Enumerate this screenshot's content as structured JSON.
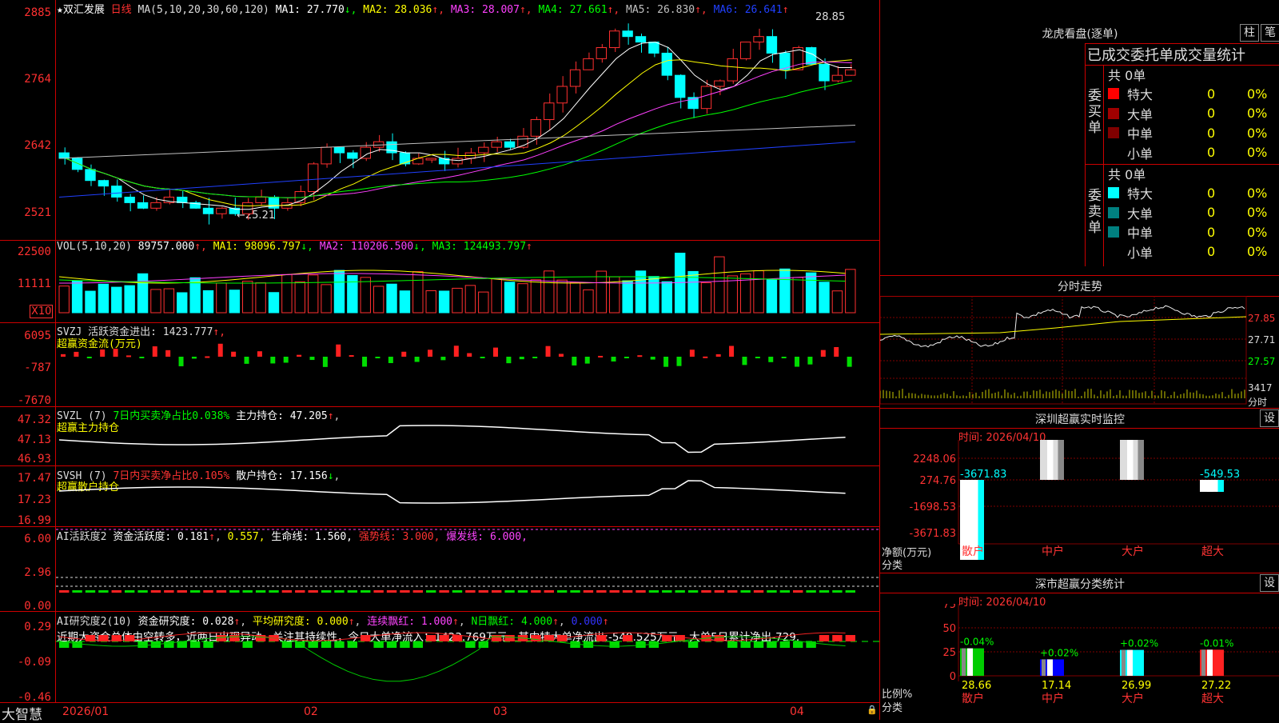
{
  "stock": {
    "name": "★双汇发展",
    "period": "日线",
    "ma_params": "MA(5,10,20,30,60,120)",
    "ma": [
      {
        "label": "MA1:",
        "value": "27.770",
        "arrow": "↓",
        "color": "#ffffff"
      },
      {
        "label": "MA2:",
        "value": "28.036",
        "arrow": "↑",
        "color": "#ffff00"
      },
      {
        "label": "MA3:",
        "value": "28.007",
        "arrow": "↑",
        "color": "#ff40ff"
      },
      {
        "label": "MA4:",
        "value": "27.661",
        "arrow": "↑",
        "color": "#00ff00"
      },
      {
        "label": "MA5:",
        "value": "26.830",
        "arrow": "↑",
        "color": "#c0c0c0"
      },
      {
        "label": "MA6:",
        "value": "26.641",
        "arrow": "↑",
        "color": "#2040ff"
      }
    ],
    "yticks": [
      "2885",
      "2764",
      "2642",
      "2521"
    ],
    "high_note": "28.85",
    "low_note": "←25.21"
  },
  "vol": {
    "params": "VOL(5,10,20)",
    "value": "89757.000",
    "ma1": "MA1: 98096.797",
    "ma2": "MA2: 110206.500",
    "ma3": "MA3: 124493.797",
    "yticks": [
      "22500",
      "11111"
    ],
    "unit": "X10"
  },
  "svzj": {
    "title": "SVZJ  活跃资金进出: 1423.777",
    "sub": "超赢资金流(万元)",
    "yticks": [
      "6095",
      "-787",
      "-7670"
    ]
  },
  "svzl": {
    "title": "SVZL (7)",
    "ratio": "7日内买卖净占比0.038%",
    "hold": "主力持仓: 47.205",
    "sub": "超赢主力持仓",
    "yticks": [
      "47.32",
      "47.13",
      "46.93"
    ]
  },
  "svsh": {
    "title": "SVSH (7)",
    "ratio": "7日内买卖净占比0.105%",
    "hold": "散户持仓: 17.156",
    "sub": "超赢散户持仓",
    "yticks": [
      "17.47",
      "17.23",
      "16.99"
    ]
  },
  "ai1": {
    "title": "AI活跃度2",
    "a": "资金活跃度: 0.181",
    "b": "0.557,",
    "c": "生命线: 1.560,",
    "d": "强势线: 3.000,",
    "e": "爆发线: 6.000,",
    "yticks": [
      "6.00",
      "2.96",
      "0.00"
    ]
  },
  "ai2": {
    "title": "AI研究度2(10)",
    "a": "资金研究度: 0.028",
    "b": "平均研究度: 0.000",
    "c": "连续飘红: 1.000",
    "d": "N日飘红: 4.000",
    "e": "0.000",
    "comment": "近期大资金总体由空转多，近两日出现异动，关注其持续性，今日大单净流入：1423.769万元，其中特大单净流出:-549.525万元，大单5日累计净出-729.",
    "yticks": [
      "0.29",
      "-0.09",
      "-0.46"
    ]
  },
  "bottom": {
    "brand": "大智慧",
    "months": [
      "2026/01",
      "02",
      "03",
      "04"
    ]
  },
  "longhu": {
    "title": "龙虎看盘(逐单)",
    "btn1": "柱",
    "btn2": "笔",
    "header": "已成交委托单成交量统计",
    "buy": {
      "label": "委买单",
      "total": "共 0单",
      "rows": [
        {
          "name": "特大",
          "v": "0",
          "p": "0%",
          "c": "#ff0000"
        },
        {
          "name": "大单",
          "v": "0",
          "p": "0%",
          "c": "#a00000"
        },
        {
          "name": "中单",
          "v": "0",
          "p": "0%",
          "c": "#800000"
        },
        {
          "name": "小单",
          "v": "0",
          "p": "0%",
          "c": "#000000"
        }
      ]
    },
    "sell": {
      "label": "委卖单",
      "total": "共 0单",
      "rows": [
        {
          "name": "特大",
          "v": "0",
          "p": "0%",
          "c": "#00ffff"
        },
        {
          "name": "大单",
          "v": "0",
          "p": "0%",
          "c": "#008080"
        },
        {
          "name": "中单",
          "v": "0",
          "p": "0%",
          "c": "#008080"
        },
        {
          "name": "小单",
          "v": "0",
          "p": "0%",
          "c": "#000000"
        }
      ]
    }
  },
  "fenshi": {
    "title": "分时走势",
    "yticks": [
      "27.85",
      "27.71",
      "27.57"
    ],
    "vol": "3417",
    "vol_label": "分时"
  },
  "sz_monitor": {
    "title": "深圳超赢实时监控",
    "btn": "设",
    "time": "时间: 2026/04/10",
    "yticks": [
      "2248.06",
      "274.76",
      "-1698.53",
      "-3671.83"
    ],
    "bars": [
      {
        "cat": "散户",
        "val": "-3671.83"
      },
      {
        "cat": "中户",
        "val": "2248.06"
      },
      {
        "cat": "大户",
        "val": "1973.29"
      },
      {
        "cat": "超大",
        "val": "-549.53"
      }
    ],
    "ylabel": "净额(万元)",
    "xlabel": "分类"
  },
  "sz_class": {
    "title": "深市超赢分类统计",
    "btn": "设",
    "time": "时间: 2026/04/10",
    "yticks": [
      "75",
      "50",
      "25",
      "0"
    ],
    "bars": [
      {
        "cat": "散户",
        "pct": "-0.04%",
        "val": "28.66"
      },
      {
        "cat": "中户",
        "pct": "+0.02%",
        "val": "17.14"
      },
      {
        "cat": "大户",
        "pct": "+0.02%",
        "val": "26.99"
      },
      {
        "cat": "超大",
        "pct": "-0.01%",
        "val": "27.22"
      }
    ],
    "ylabel": "比例%",
    "xlabel": "分类"
  }
}
